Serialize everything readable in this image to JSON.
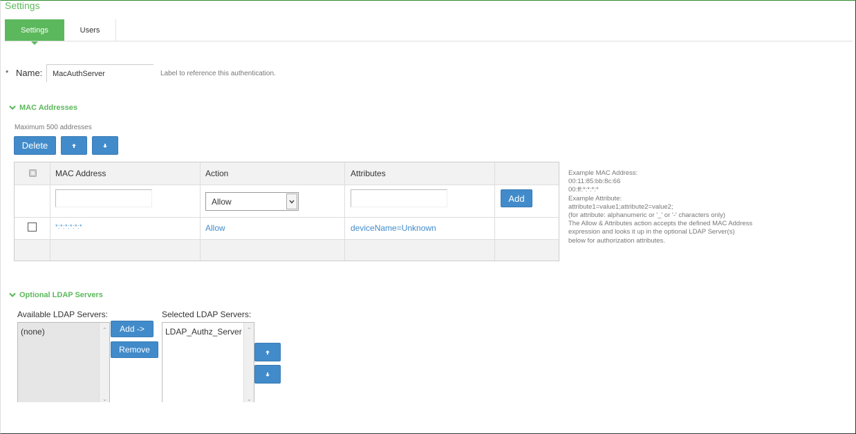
{
  "page": {
    "title": "Settings"
  },
  "tabs": [
    {
      "label": "Settings",
      "active": true
    },
    {
      "label": "Users",
      "active": false
    }
  ],
  "name_field": {
    "required_mark": "*",
    "label": "Name:",
    "value": "MacAuthServer",
    "hint": "Label to reference this authentication."
  },
  "mac_section": {
    "title": "MAC Addresses",
    "max_note": "Maximum 500 addresses",
    "delete_label": "Delete",
    "add_label": "Add",
    "table": {
      "headers": [
        "MAC Address",
        "Action",
        "Attributes"
      ],
      "new_row": {
        "action_selected": "Allow",
        "mac_value": "",
        "attributes_value": ""
      },
      "rows": [
        {
          "mac": "*:*:*:*:*:*",
          "action": "Allow",
          "attributes": "deviceName=Unknown"
        }
      ]
    },
    "help_lines": [
      "Example MAC Address:",
      "00:11:85:bb:8c:66",
      "00:ff:*:*:*:*",
      "Example Attribute:",
      "attribute1=value1;attribute2=value2;",
      "(for attribute: alphanumeric or '_' or '-' characters only)",
      "The Allow & Attributes action accepts the defined MAC Address",
      "expression and looks it up in the optional LDAP Server(s)",
      "below for authorization attributes."
    ]
  },
  "ldap_section": {
    "title": "Optional LDAP Servers",
    "available_label": "Available LDAP Servers:",
    "available_items": [
      "(none)"
    ],
    "selected_label": "Selected LDAP Servers:",
    "selected_items": [
      "LDAP_Authz_Server"
    ],
    "add_label": "Add ->",
    "remove_label": "Remove"
  },
  "colors": {
    "accent_green": "#5cb85c",
    "button_blue": "#428bca",
    "link_blue": "#428bca"
  },
  "icons": {
    "section_toggle": "chevron-down-icon",
    "move_up": "arrow-up-icon",
    "move_down": "arrow-down-icon"
  }
}
